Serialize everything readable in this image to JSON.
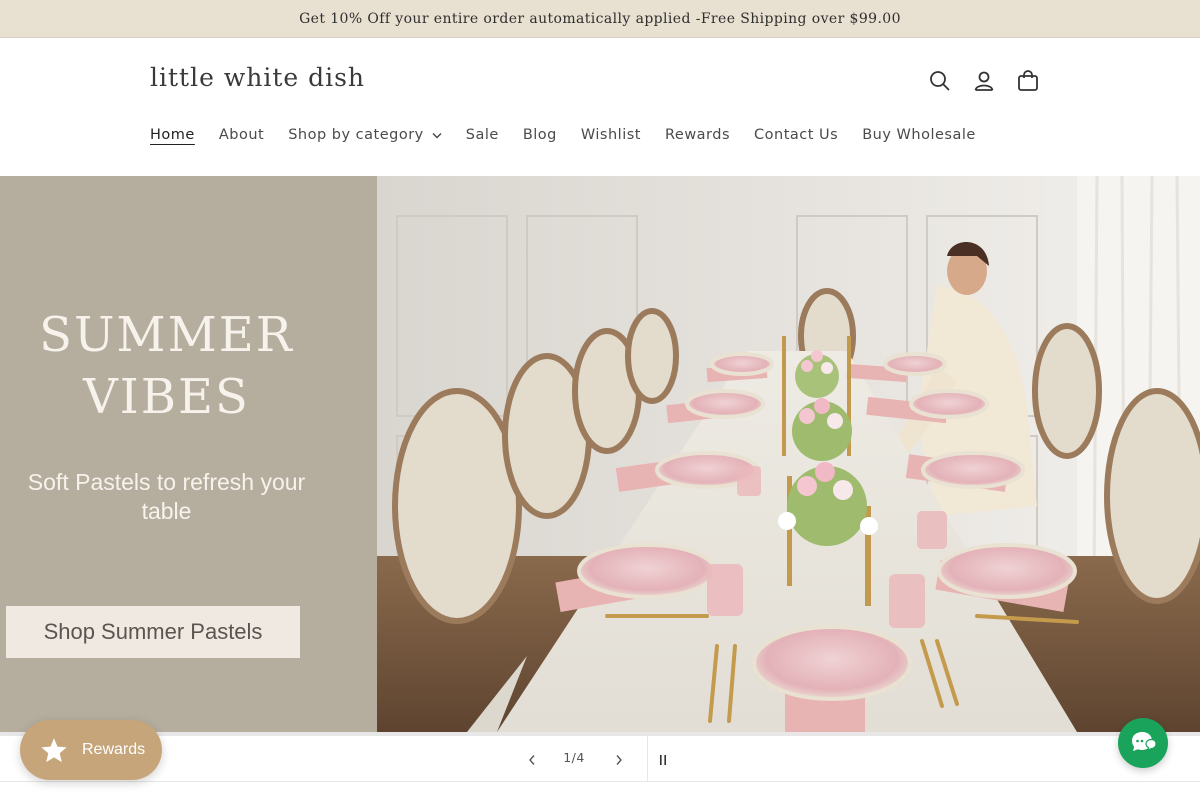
{
  "announcement": {
    "text": "Get 10% Off your entire order automatically applied -Free Shipping over $99.00"
  },
  "header": {
    "logo": "little white dish",
    "icons": [
      "search-icon",
      "account-icon",
      "cart-icon"
    ]
  },
  "nav": {
    "items": [
      {
        "label": "Home",
        "active": true
      },
      {
        "label": "About"
      },
      {
        "label": "Shop by category",
        "has_dropdown": true
      },
      {
        "label": "Sale"
      },
      {
        "label": "Blog"
      },
      {
        "label": "Wishlist"
      },
      {
        "label": "Rewards"
      },
      {
        "label": "Contact Us"
      },
      {
        "label": "Buy Wholesale"
      }
    ]
  },
  "hero": {
    "heading_line1": "SUMMER",
    "heading_line2": "VIBES",
    "subheading": "Soft Pastels to refresh your table",
    "cta_label": "Shop Summer Pastels",
    "panel_color": "#b5ae9f"
  },
  "slideshow": {
    "counter": "1/4",
    "current": 1,
    "total": 4
  },
  "widgets": {
    "rewards_label": "Rewards",
    "rewards_color": "#c7a57a",
    "chat_color": "#19a35b"
  }
}
